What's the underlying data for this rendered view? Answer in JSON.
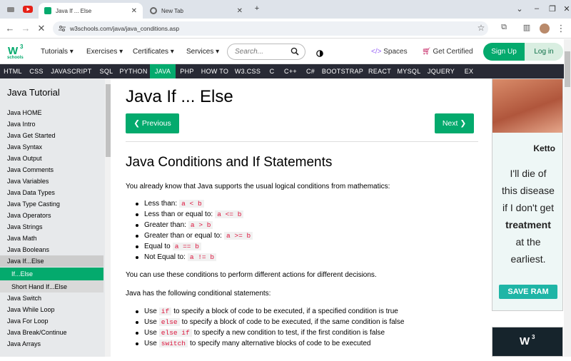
{
  "browser": {
    "tabs": [
      {
        "title": "Java If ... Else",
        "active": true
      },
      {
        "title": "New Tab",
        "active": false
      }
    ],
    "url": "w3schools.com/java/java_conditions.asp"
  },
  "header": {
    "logo_sub": "schools",
    "menus": [
      "Tutorials",
      "Exercises",
      "Certificates",
      "Services"
    ],
    "search_placeholder": "Search...",
    "spaces": "Spaces",
    "get_certified": "Get Certified",
    "signup": "Sign Up",
    "login": "Log in"
  },
  "topnav": [
    "HTML",
    "CSS",
    "JAVASCRIPT",
    "SQL",
    "PYTHON",
    "JAVA",
    "PHP",
    "HOW TO",
    "W3.CSS",
    "C",
    "C++",
    "C#",
    "BOOTSTRAP",
    "REACT",
    "MYSQL",
    "JQUERY",
    "EX"
  ],
  "topnav_active": "JAVA",
  "sidebar": {
    "title": "Java Tutorial",
    "items": [
      "Java HOME",
      "Java Intro",
      "Java Get Started",
      "Java Syntax",
      "Java Output",
      "Java Comments",
      "Java Variables",
      "Java Data Types",
      "Java Type Casting",
      "Java Operators",
      "Java Strings",
      "Java Math",
      "Java Booleans",
      "Java If...Else",
      "If...Else",
      "Short Hand If...Else",
      "Java Switch",
      "Java While Loop",
      "Java For Loop",
      "Java Break/Continue",
      "Java Arrays"
    ]
  },
  "main": {
    "title": "Java If ... Else",
    "prev": "❮ Previous",
    "next": "Next ❯",
    "section_title": "Java Conditions and If Statements",
    "intro": "You already know that Java supports the usual logical conditions from mathematics:",
    "conditions": [
      {
        "text": "Less than:",
        "code": "a < b"
      },
      {
        "text": "Less than or equal to:",
        "code": "a <= b"
      },
      {
        "text": "Greater than:",
        "code": "a > b"
      },
      {
        "text": "Greater than or equal to:",
        "code": "a >= b"
      },
      {
        "text": "Equal to",
        "code": "a == b"
      },
      {
        "text": "Not Equal to:",
        "code": "a != b"
      }
    ],
    "p2": "You can use these conditions to perform different actions for different decisions.",
    "p3": "Java has the following conditional statements:",
    "statements": [
      {
        "pre": "Use",
        "code": "if",
        "post": "to specify a block of code to be executed, if a specified condition is true"
      },
      {
        "pre": "Use",
        "code": "else",
        "post": "to specify a block of code to be executed, if the same condition is false"
      },
      {
        "pre": "Use",
        "code": "else if",
        "post": "to specify a new condition to test, if the first condition is false"
      },
      {
        "pre": "Use",
        "code": "switch",
        "post": "to specify many alternative blocks of code to be executed"
      }
    ]
  },
  "ad": {
    "brand": "Ketto",
    "lines": [
      "I'll die of",
      "this disease",
      "if I don't get",
      "treatment",
      "at the",
      "earliest."
    ],
    "button": "SAVE RAM"
  },
  "colors": {
    "accent": "#04aa6d",
    "nav_dark": "#282a35",
    "sidebar_bg": "#e7e9eb",
    "code_red": "#dc143c"
  }
}
